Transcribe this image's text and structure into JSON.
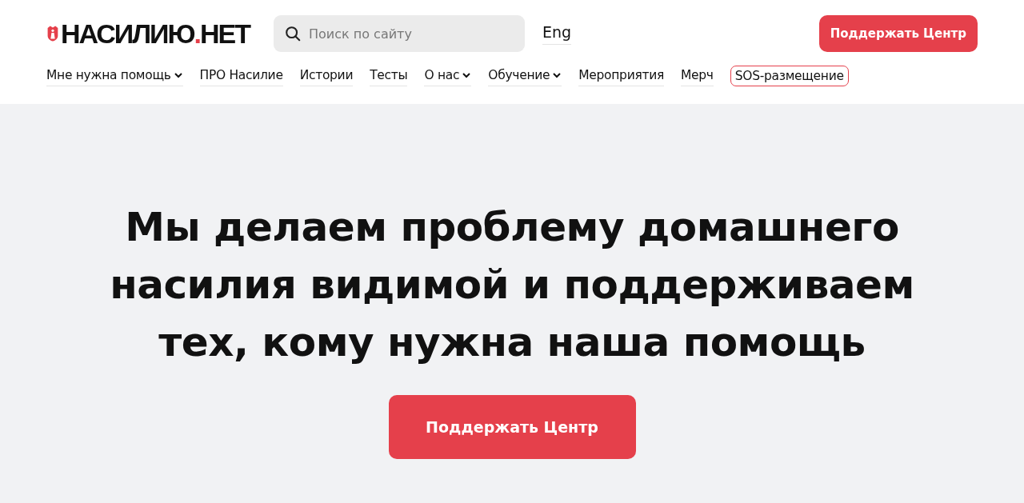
{
  "header": {
    "logo": {
      "name": "НАСИЛИЮ",
      "dot": ".",
      "suffix": "НЕТ"
    },
    "search": {
      "placeholder": "Поиск по сайту"
    },
    "language": "Eng",
    "donate_button": "Поддержать Центр"
  },
  "nav": [
    {
      "label": "Мне нужна помощь",
      "dropdown": true,
      "kind": "link"
    },
    {
      "label": "ПРО Насилие",
      "dropdown": false,
      "kind": "link"
    },
    {
      "label": "Истории",
      "dropdown": false,
      "kind": "link"
    },
    {
      "label": "Тесты",
      "dropdown": false,
      "kind": "link"
    },
    {
      "label": "О нас",
      "dropdown": true,
      "kind": "link"
    },
    {
      "label": "Обучение",
      "dropdown": true,
      "kind": "link"
    },
    {
      "label": "Мероприятия",
      "dropdown": false,
      "kind": "link"
    },
    {
      "label": "Мерч",
      "dropdown": false,
      "kind": "link"
    },
    {
      "label": "SOS-размещение",
      "dropdown": false,
      "kind": "outlined"
    }
  ],
  "hero": {
    "title": "Мы делаем проблему домашнего насилия видимой и поддерживаем тех, кому нужна наша помощь",
    "button": "Поддержать Центр"
  }
}
